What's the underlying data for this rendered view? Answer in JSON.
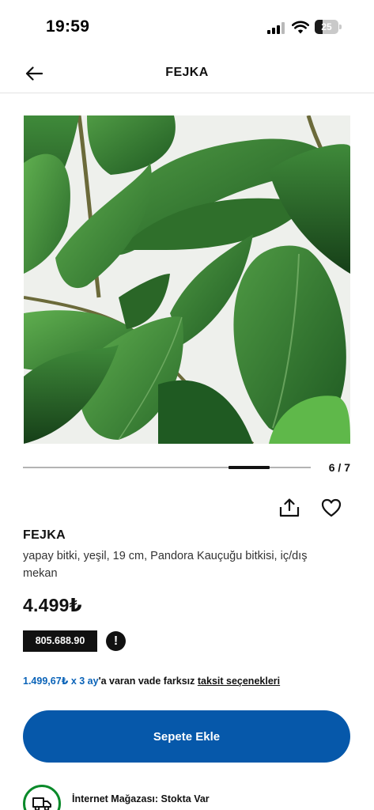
{
  "status_bar": {
    "time": "19:59",
    "battery_level": "25"
  },
  "nav": {
    "title": "FEJKA",
    "back_icon": "arrow-left-icon"
  },
  "gallery": {
    "image_subject": "artificial rubber plant leaves",
    "counter": "6 / 7",
    "current_index": 6,
    "total": 7
  },
  "actions": {
    "share_icon": "share-icon",
    "favorite_icon": "heart-icon"
  },
  "product": {
    "name": "FEJKA",
    "description": "yapay bitki, yeşil, 19 cm, Pandora Kauçuğu bitkisi, iç/dış mekan",
    "price": "4.499₺",
    "article_number": "805.688.90",
    "info_icon": "exclamation-icon"
  },
  "installment": {
    "amount": "1.499,67₺ x 3 ay",
    "text": "'a varan vade farksız ",
    "link": "taksit seçenekleri"
  },
  "cart": {
    "button_label": "Sepete Ekle"
  },
  "stock": {
    "icon": "delivery-truck-icon",
    "label": "İnternet Mağazası: Stokta Var"
  },
  "colors": {
    "brand_blue": "#0658aa",
    "link_blue": "#0a63b8",
    "stock_green": "#0a8a2a"
  }
}
